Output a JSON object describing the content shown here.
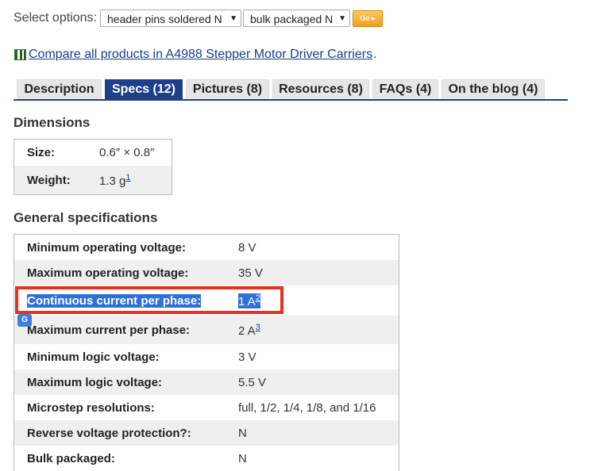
{
  "options": {
    "label": "Select options:",
    "select1": "header pins soldered N",
    "select2": "bulk packaged N",
    "go": "Go ▸"
  },
  "compare": {
    "link": "Compare all products in A4988 Stepper Motor Driver Carriers",
    "dot": "."
  },
  "tabs": [
    {
      "label": "Description"
    },
    {
      "label": "Specs (12)"
    },
    {
      "label": "Pictures (8)"
    },
    {
      "label": "Resources (8)"
    },
    {
      "label": "FAQs (4)"
    },
    {
      "label": "On the blog (4)"
    }
  ],
  "dimensions": {
    "title": "Dimensions",
    "rows": [
      {
        "label": "Size:",
        "value": "0.6″ × 0.8″",
        "note": ""
      },
      {
        "label": "Weight:",
        "value": "1.3 g",
        "note": "1"
      }
    ]
  },
  "general": {
    "title": "General specifications",
    "rows": [
      {
        "label": "Minimum operating voltage:",
        "value": "8 V",
        "note": ""
      },
      {
        "label": "Maximum operating voltage:",
        "value": "35 V",
        "note": ""
      },
      {
        "label": "Continuous current per phase:",
        "value": "1 A",
        "note": "2"
      },
      {
        "label": "Maximum current per phase:",
        "value": "2 A",
        "note": "3"
      },
      {
        "label": "Minimum logic voltage:",
        "value": "3 V",
        "note": ""
      },
      {
        "label": "Maximum logic voltage:",
        "value": "5.5 V",
        "note": ""
      },
      {
        "label": "Microstep resolutions:",
        "value": "full, 1/2, 1/4, 1/8, and 1/16",
        "note": ""
      },
      {
        "label": "Reverse voltage protection?:",
        "value": "N",
        "note": ""
      },
      {
        "label": "Bulk packaged:",
        "value": "N",
        "note": ""
      }
    ]
  },
  "icons": {
    "compare": "compare-table-icon",
    "translate": "google-translate-icon",
    "dropdown": "dropdown-arrow-icon"
  },
  "colors": {
    "tab_active": "#1f3f8a",
    "highlight": "#e8321e",
    "selection": "#2f6fd6",
    "go_button": "#f0a020"
  }
}
